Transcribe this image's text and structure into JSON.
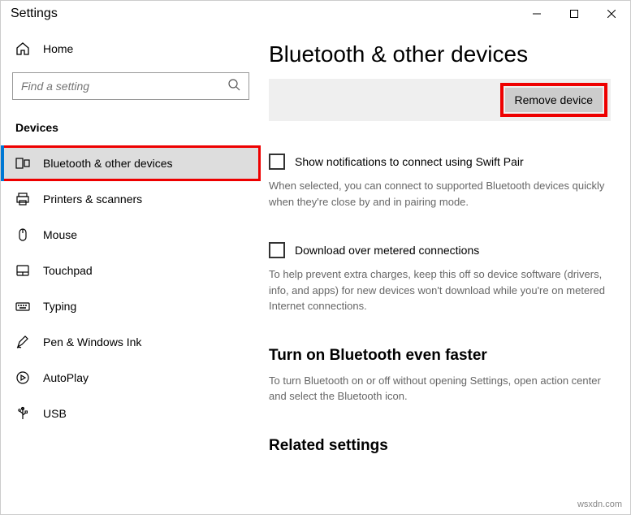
{
  "window": {
    "title": "Settings"
  },
  "sidebar": {
    "home_label": "Home",
    "search_placeholder": "Find a setting",
    "section_header": "Devices",
    "items": [
      {
        "label": "Bluetooth & other devices"
      },
      {
        "label": "Printers & scanners"
      },
      {
        "label": "Mouse"
      },
      {
        "label": "Touchpad"
      },
      {
        "label": "Typing"
      },
      {
        "label": "Pen & Windows Ink"
      },
      {
        "label": "AutoPlay"
      },
      {
        "label": "USB"
      }
    ]
  },
  "main": {
    "title": "Bluetooth & other devices",
    "remove_button": "Remove device",
    "swift_pair": {
      "label": "Show notifications to connect using Swift Pair",
      "help": "When selected, you can connect to supported Bluetooth devices quickly when they're close by and in pairing mode."
    },
    "metered": {
      "label": "Download over metered connections",
      "help": "To help prevent extra charges, keep this off so device software (drivers, info, and apps) for new devices won't download while you're on metered Internet connections."
    },
    "bt_faster": {
      "heading": "Turn on Bluetooth even faster",
      "help": "To turn Bluetooth on or off without opening Settings, open action center and select the Bluetooth icon."
    },
    "related_heading": "Related settings"
  },
  "watermark": "wsxdn.com"
}
